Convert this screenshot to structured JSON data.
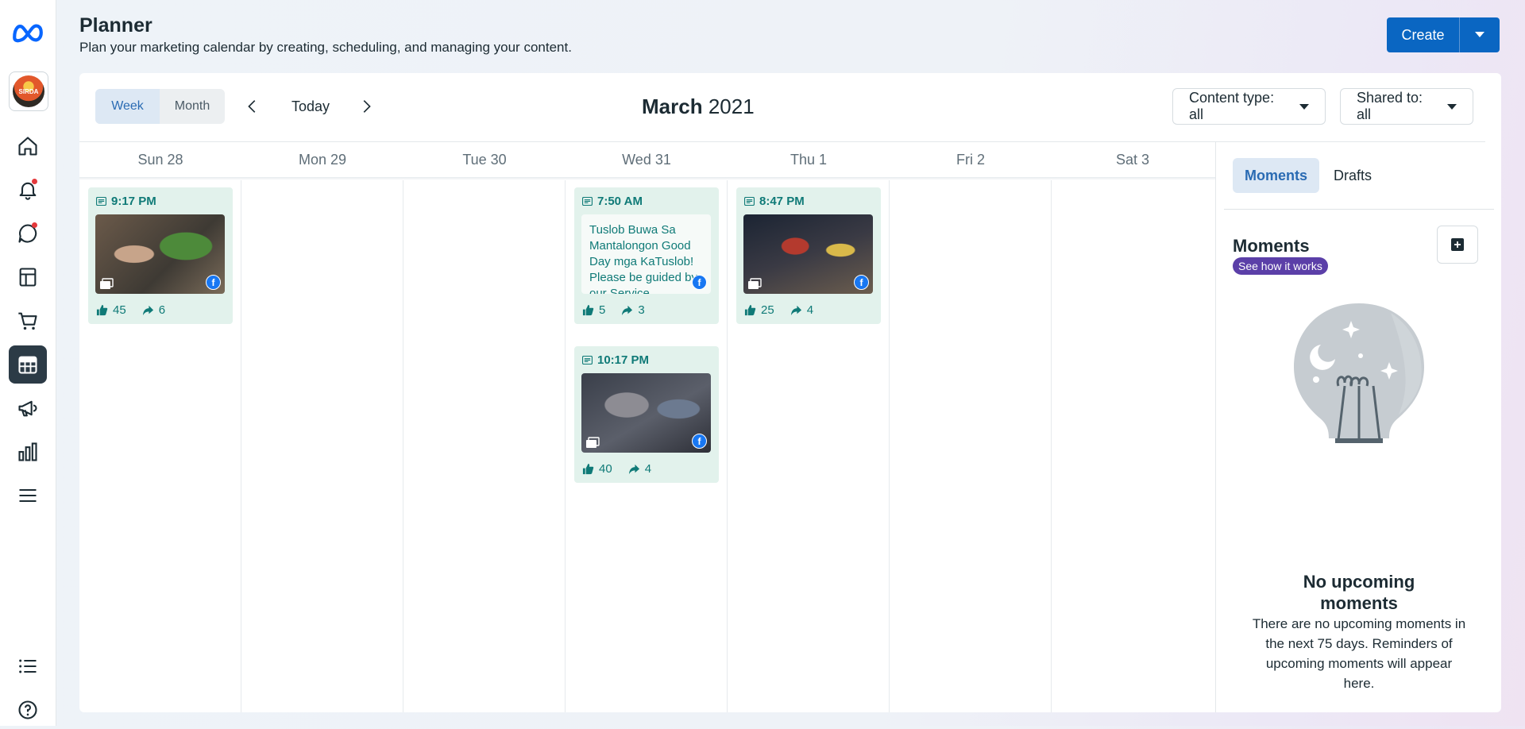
{
  "header": {
    "title": "Planner",
    "subtitle": "Plan your marketing calendar by creating, scheduling, and managing your content.",
    "create_label": "Create"
  },
  "nav": {
    "items": [
      "meta-logo-icon",
      "page-avatar",
      "home-icon",
      "notifications-icon",
      "inbox-icon",
      "content-icon",
      "commerce-icon",
      "planner-icon",
      "ads-icon",
      "insights-icon",
      "all-tools-icon",
      "edit-page-icon",
      "help-icon"
    ],
    "active": "planner-icon",
    "notification_dots": [
      "notifications-icon",
      "inbox-icon"
    ],
    "avatar_text": "SIRDA"
  },
  "toolbar": {
    "week_label": "Week",
    "month_label": "Month",
    "today_label": "Today",
    "month_name": "March",
    "year": "2021",
    "content_type_label": "Content type: all",
    "shared_to_label": "Shared to: all"
  },
  "days": [
    "Sun 28",
    "Mon 29",
    "Tue 30",
    "Wed 31",
    "Thu 1",
    "Fri 2",
    "Sat 3"
  ],
  "posts": [
    {
      "day": "Sun 28",
      "time": "9:17 PM",
      "media": "photo",
      "likes": "45",
      "shares": "6"
    },
    {
      "day": "Wed 31",
      "time": "7:50 AM",
      "media": "text",
      "text": "Tuslob Buwa Sa Mantalongon Good Day mga KaTuslob! Please be guided by our Service",
      "likes": "5",
      "shares": "3"
    },
    {
      "day": "Wed 31",
      "time": "10:17 PM",
      "media": "photo",
      "likes": "40",
      "shares": "4"
    },
    {
      "day": "Thu 1",
      "time": "8:47 PM",
      "media": "photo",
      "likes": "25",
      "shares": "4"
    }
  ],
  "sidebar": {
    "tab_moments": "Moments",
    "tab_drafts": "Drafts",
    "moments_title": "Moments",
    "see_how_label": "See how it works",
    "empty_title": "No upcoming moments",
    "empty_text": "There are no upcoming moments in the next 75 days. Reminders of upcoming moments will appear here."
  },
  "colors": {
    "accent": "#0a66c2",
    "card_bg": "#e2f2ec",
    "card_text": "#0f7a77",
    "badge_purple": "#5b3fa8",
    "facebook_blue": "#1877f2"
  }
}
